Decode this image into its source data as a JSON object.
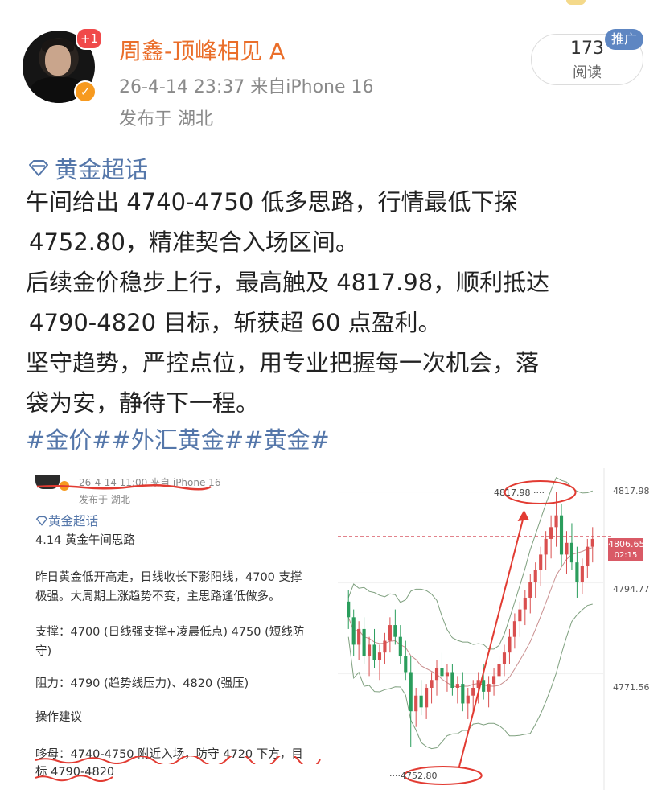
{
  "post": {
    "avatar_badge": "+1",
    "username": "周鑫-顶峰相见 A",
    "meta": "26-4-14 23:37  来自iPhone 16",
    "location": "发布于 湖北",
    "read_count": "173",
    "read_label": "阅读",
    "ad_badge": "推广",
    "topic": "黄金超话",
    "paragraphs": [
      "午间给出 4740-4750 低多思路，行情最低下探",
      "4752.80，精准契合入场区间。",
      "后续金价稳步上行，最高触及 4817.98，顺利抵达",
      "4790-4820 目标，斩获超 60 点盈利。",
      "坚守趋势，严控点位，用专业把握每一次机会，落",
      "袋为安，静待下一程。"
    ],
    "hashtags": "#金价##外汇黄金##黄金#"
  },
  "embedded": {
    "meta": "26-4-14 11:00  来自 iPhone 16",
    "location": "发布于 湖北",
    "topic": "黄金超话",
    "title": "4.14 黄金午间思路",
    "lines": [
      "昨日黄金低开高走，日线收长下影阳线，4700 支撑",
      "极强。大周期上涨趋势不变，主思路逢低做多。",
      "支撑：4700 (日线强支撑+凌晨低点) 4750 (短线防",
      "守)",
      "阻力：4790 (趋势线压力)、4820 (强压)",
      "操作建议",
      "哆母：4740-4750 附近入场，防守 4720 下方，目",
      "标 4790-4820"
    ]
  },
  "chart_data": {
    "type": "candlestick",
    "y_ticks": [
      "4817.98",
      "4794.77",
      "4771.56"
    ],
    "current_price": "4806.65",
    "countdown": "02:15",
    "annotation_high": "4817.98 ····",
    "annotation_low": "····4752.80",
    "ylim": [
      4745,
      4822
    ],
    "candles": [
      [
        4790,
        4793,
        4783,
        4786
      ],
      [
        4786,
        4788,
        4776,
        4779
      ],
      [
        4779,
        4785,
        4775,
        4783
      ],
      [
        4783,
        4786,
        4774,
        4776
      ],
      [
        4776,
        4781,
        4771,
        4779
      ],
      [
        4779,
        4783,
        4773,
        4775
      ],
      [
        4775,
        4779,
        4770,
        4777
      ],
      [
        4777,
        4782,
        4774,
        4780
      ],
      [
        4780,
        4786,
        4777,
        4784
      ],
      [
        4784,
        4788,
        4779,
        4781
      ],
      [
        4781,
        4784,
        4774,
        4776
      ],
      [
        4776,
        4780,
        4770,
        4772
      ],
      [
        4772,
        4776,
        4753,
        4762
      ],
      [
        4762,
        4768,
        4758,
        4766
      ],
      [
        4766,
        4770,
        4761,
        4763
      ],
      [
        4763,
        4769,
        4760,
        4768
      ],
      [
        4768,
        4772,
        4764,
        4770
      ],
      [
        4770,
        4775,
        4766,
        4773
      ],
      [
        4773,
        4777,
        4769,
        4771
      ],
      [
        4771,
        4774,
        4767,
        4772
      ],
      [
        4772,
        4774,
        4766,
        4768
      ],
      [
        4768,
        4771,
        4764,
        4769
      ],
      [
        4769,
        4772,
        4762,
        4764
      ],
      [
        4764,
        4768,
        4760,
        4766
      ],
      [
        4766,
        4770,
        4762,
        4768
      ],
      [
        4768,
        4772,
        4764,
        4770
      ],
      [
        4770,
        4774,
        4765,
        4767
      ],
      [
        4767,
        4771,
        4763,
        4769
      ],
      [
        4769,
        4773,
        4766,
        4771
      ],
      [
        4771,
        4776,
        4768,
        4774
      ],
      [
        4774,
        4779,
        4771,
        4777
      ],
      [
        4777,
        4783,
        4774,
        4781
      ],
      [
        4781,
        4787,
        4778,
        4785
      ],
      [
        4785,
        4790,
        4781,
        4788
      ],
      [
        4788,
        4793,
        4784,
        4791
      ],
      [
        4791,
        4797,
        4787,
        4795
      ],
      [
        4795,
        4800,
        4791,
        4798
      ],
      [
        4798,
        4804,
        4794,
        4802
      ],
      [
        4802,
        4808,
        4798,
        4806
      ],
      [
        4806,
        4812,
        4801,
        4809
      ],
      [
        4809,
        4818,
        4804,
        4812
      ],
      [
        4812,
        4815,
        4799,
        4802
      ],
      [
        4802,
        4808,
        4797,
        4805
      ],
      [
        4805,
        4810,
        4798,
        4800
      ],
      [
        4800,
        4804,
        4791,
        4795
      ],
      [
        4795,
        4801,
        4792,
        4799
      ],
      [
        4799,
        4806,
        4796,
        4804
      ],
      [
        4804,
        4809,
        4800,
        4806
      ]
    ]
  }
}
